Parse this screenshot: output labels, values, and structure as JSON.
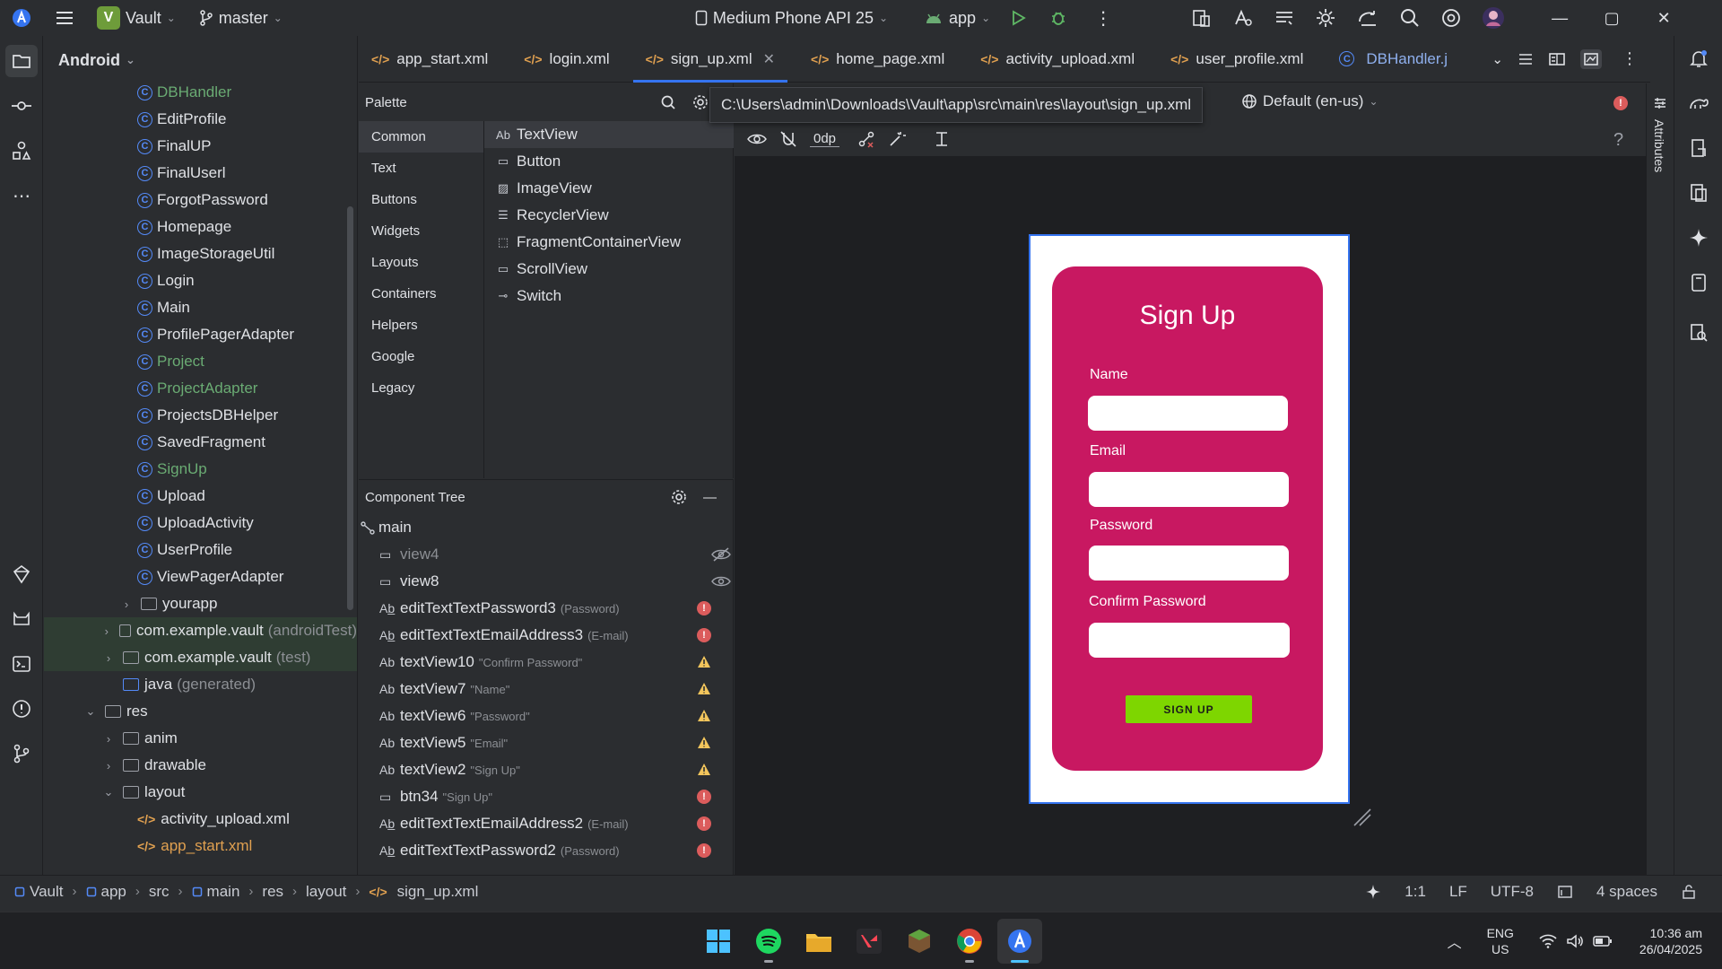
{
  "titlebar": {
    "project_badge": "V",
    "project_name": "Vault",
    "branch": "master",
    "device": "Medium Phone API 25",
    "run_config": "app"
  },
  "sidebar_header": {
    "view": "Android"
  },
  "project_tree": [
    {
      "label": "DBHandler",
      "type": "class",
      "green": true,
      "indent": 3
    },
    {
      "label": "EditProfile",
      "type": "class",
      "indent": 3
    },
    {
      "label": "FinalUP",
      "type": "class",
      "indent": 3
    },
    {
      "label": "FinalUserl",
      "type": "class",
      "indent": 3
    },
    {
      "label": "ForgotPassword",
      "type": "class",
      "indent": 3
    },
    {
      "label": "Homepage",
      "type": "class",
      "indent": 3
    },
    {
      "label": "ImageStorageUtil",
      "type": "class",
      "indent": 3
    },
    {
      "label": "Login",
      "type": "class",
      "indent": 3
    },
    {
      "label": "Main",
      "type": "class",
      "indent": 3
    },
    {
      "label": "ProfilePagerAdapter",
      "type": "class",
      "indent": 3
    },
    {
      "label": "Project",
      "type": "class",
      "green": true,
      "indent": 3
    },
    {
      "label": "ProjectAdapter",
      "type": "class",
      "green": true,
      "indent": 3
    },
    {
      "label": "ProjectsDBHelper",
      "type": "class",
      "indent": 3
    },
    {
      "label": "SavedFragment",
      "type": "class",
      "indent": 3
    },
    {
      "label": "SignUp",
      "type": "class",
      "green": true,
      "indent": 3
    },
    {
      "label": "Upload",
      "type": "class",
      "indent": 3
    },
    {
      "label": "UploadActivity",
      "type": "class",
      "indent": 3
    },
    {
      "label": "UserProfile",
      "type": "class",
      "indent": 3
    },
    {
      "label": "ViewPagerAdapter",
      "type": "class",
      "indent": 3
    },
    {
      "label": "yourapp",
      "type": "folder",
      "chev": "›",
      "indent": 2
    },
    {
      "label": "com.example.vault",
      "extra": "(androidTest)",
      "type": "folder",
      "chev": "›",
      "indent": 1,
      "hl": true
    },
    {
      "label": "com.example.vault",
      "extra": "(test)",
      "type": "folder",
      "chev": "›",
      "indent": 1,
      "hl": true
    },
    {
      "label": "java",
      "extra": "(generated)",
      "type": "folder-blue",
      "indent": 1
    },
    {
      "label": "res",
      "type": "folder",
      "chev": "⌄",
      "indent": 0
    },
    {
      "label": "anim",
      "type": "folder",
      "chev": "›",
      "indent": 1
    },
    {
      "label": "drawable",
      "type": "folder",
      "chev": "›",
      "indent": 1
    },
    {
      "label": "layout",
      "type": "folder",
      "chev": "⌄",
      "indent": 1
    },
    {
      "label": "activity_upload.xml",
      "type": "xml",
      "indent": 2
    },
    {
      "label": "app_start.xml",
      "type": "xml",
      "orange": true,
      "indent": 2
    }
  ],
  "tabs": [
    {
      "label": "app_start.xml",
      "kind": "xml"
    },
    {
      "label": "login.xml",
      "kind": "xml"
    },
    {
      "label": "sign_up.xml",
      "kind": "xml",
      "active": true
    },
    {
      "label": "home_page.xml",
      "kind": "xml"
    },
    {
      "label": "activity_upload.xml",
      "kind": "xml"
    },
    {
      "label": "user_profile.xml",
      "kind": "xml"
    },
    {
      "label": "DBHandler.j",
      "kind": "class"
    }
  ],
  "palette": {
    "title": "Palette",
    "categories": [
      "Common",
      "Text",
      "Buttons",
      "Widgets",
      "Layouts",
      "Containers",
      "Helpers",
      "Google",
      "Legacy"
    ],
    "items": [
      {
        "icon": "Ab",
        "label": "TextView"
      },
      {
        "icon": "▭",
        "label": "Button"
      },
      {
        "icon": "▨",
        "label": "ImageView"
      },
      {
        "icon": "☰",
        "label": "RecyclerView"
      },
      {
        "icon": "⬚",
        "label": "FragmentContainerView"
      },
      {
        "icon": "▭",
        "label": "ScrollView"
      },
      {
        "icon": "⊸",
        "label": "Switch"
      }
    ]
  },
  "tooltip": {
    "path": "C:\\Users\\admin\\Downloads\\Vault\\app\\src\\main\\res\\layout\\sign_up.xml"
  },
  "design_toolbar": {
    "locale": "Default (en-us)",
    "margin": "0dp",
    "help": "?"
  },
  "component_tree": {
    "title": "Component Tree",
    "root": "main",
    "items": [
      {
        "icon": "▭",
        "id": "view4",
        "dim": true,
        "vis": "hidden"
      },
      {
        "icon": "▭",
        "id": "view8",
        "vis": "visible"
      },
      {
        "icon": "Ab̲",
        "id": "editTextTextPassword3",
        "hint": "(Password)",
        "status": "error"
      },
      {
        "icon": "Ab̲",
        "id": "editTextTextEmailAddress3",
        "hint": "(E-mail)",
        "status": "error"
      },
      {
        "icon": "Ab",
        "id": "textView10",
        "hint": "\"Confirm Password\"",
        "status": "warning"
      },
      {
        "icon": "Ab",
        "id": "textView7",
        "hint": "\"Name\"",
        "status": "warning"
      },
      {
        "icon": "Ab",
        "id": "textView6",
        "hint": "\"Password\"",
        "status": "warning"
      },
      {
        "icon": "Ab",
        "id": "textView5",
        "hint": "\"Email\"",
        "status": "warning"
      },
      {
        "icon": "Ab",
        "id": "textView2",
        "hint": "\"Sign Up\"",
        "status": "warning"
      },
      {
        "icon": "▭",
        "id": "btn34",
        "hint": "\"Sign Up\"",
        "status": "error"
      },
      {
        "icon": "Ab̲",
        "id": "editTextTextEmailAddress2",
        "hint": "(E-mail)",
        "status": "error"
      },
      {
        "icon": "Ab̲",
        "id": "editTextTextPassword2",
        "hint": "(Password)",
        "status": "error"
      }
    ]
  },
  "phone_preview": {
    "title": "Sign Up",
    "card_color": "#c81861",
    "button_color": "#7ed600",
    "fields": [
      "Name",
      "Email",
      "Password",
      "Confirm Password"
    ],
    "button_label": "SIGN UP"
  },
  "attributes_label": "Attributes",
  "statusbar": {
    "breadcrumbs": [
      "Vault",
      "app",
      "src",
      "main",
      "res",
      "layout",
      "sign_up.xml"
    ],
    "position": "1:1",
    "line_sep": "LF",
    "encoding": "UTF-8",
    "indent": "4 spaces"
  },
  "taskbar": {
    "lang": "ENG",
    "region": "US",
    "time": "10:36 am",
    "date": "26/04/2025"
  }
}
